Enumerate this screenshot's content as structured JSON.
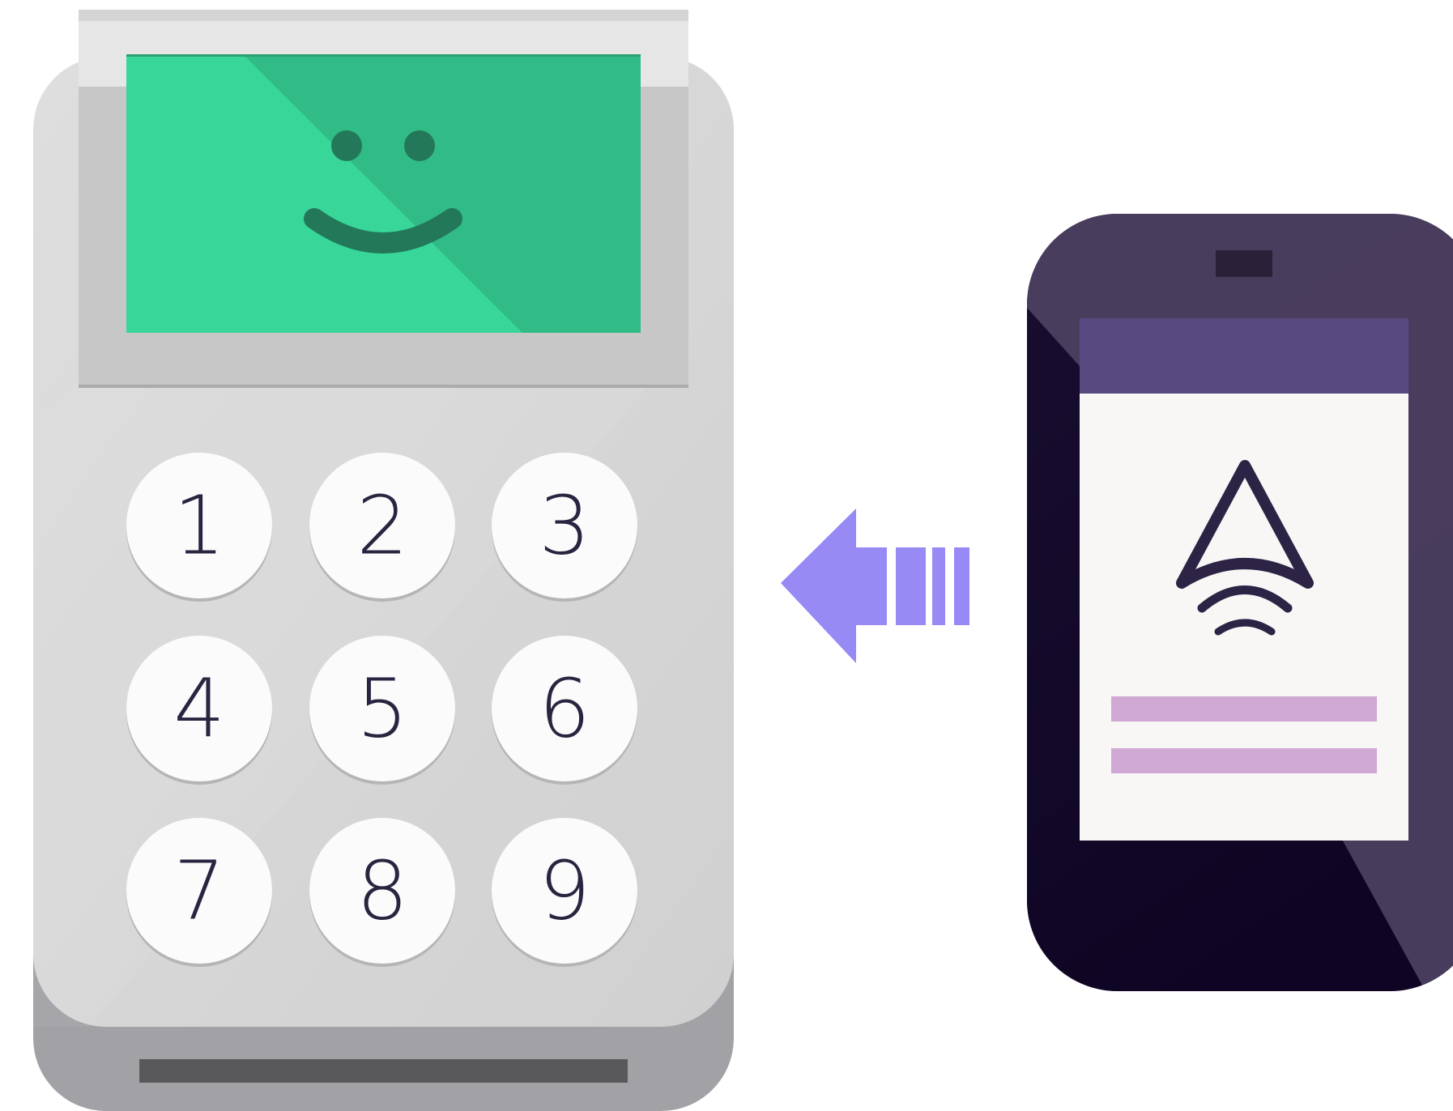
{
  "keypad": {
    "keys": [
      "1",
      "2",
      "3",
      "4",
      "5",
      "6",
      "7",
      "8",
      "9"
    ]
  },
  "colors": {
    "terminal_body": "#d6d6d6",
    "terminal_base": "#a2a2a6",
    "terminal_slot": "#59595c",
    "screen_green": "#38d698",
    "screen_green_dark": "#31bb86",
    "smile_face": "#23785a",
    "key_face": "#fbfbfb",
    "phone_body": "#1b1030",
    "phone_header": "#574a81",
    "phone_screen": "#f8f7f6",
    "logo": "#2c2345",
    "text_bar": "#d0a8d4",
    "arrow": "#978af5"
  },
  "icons": {
    "terminal_face": "smiley-face-icon",
    "phone_logo": "contactless-payment-icon",
    "transfer_arrow": "arrow-left-icon"
  }
}
